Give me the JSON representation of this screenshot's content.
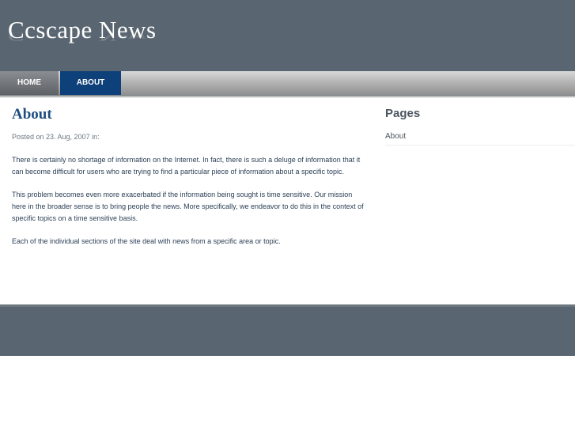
{
  "site": {
    "title": "Ccscape News"
  },
  "nav": {
    "items": [
      {
        "label": "HOME"
      },
      {
        "label": "ABOUT"
      }
    ]
  },
  "main": {
    "heading": "About",
    "posted": "Posted on 23. Aug, 2007 in:",
    "paragraphs": [
      "There is certainly no shortage of information on the Internet. In fact, there is such a deluge of information that it can become difficult for users who are trying to find a particular piece of information about a specific topic.",
      "This problem becomes even more exacerbated if the information being sought is time sensitive. Our mission here in the broader sense is to bring people the news. More specifically, we endeavor to do this in the context of specific topics on a time sensitive basis.",
      "Each of the individual sections of the site deal with news from a specific area or topic."
    ]
  },
  "sidebar": {
    "heading": "Pages",
    "links": [
      {
        "label": "About"
      }
    ]
  },
  "colors": {
    "header_bg": "#596570",
    "nav_active": "#0e4079",
    "heading": "#1e4d80"
  }
}
